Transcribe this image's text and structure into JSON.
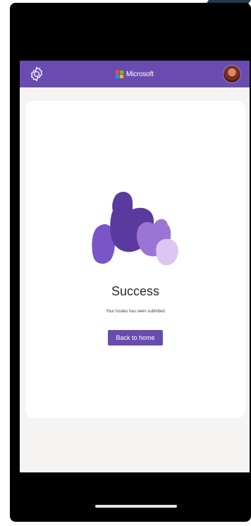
{
  "header": {
    "brand": "Microsoft",
    "settings_icon": "gear-icon",
    "profile_icon": "avatar",
    "brand_colors": {
      "bar": "#6a4cb0",
      "logo_red": "#f25022",
      "logo_green": "#7fba00",
      "logo_blue": "#00a4ef",
      "logo_yellow": "#ffb900"
    }
  },
  "success": {
    "illustration_icon": "thumbs-up-hands-icon",
    "title": "Success",
    "message": "Your lusdes has oeen subiritted",
    "button_label": "Back to home"
  }
}
